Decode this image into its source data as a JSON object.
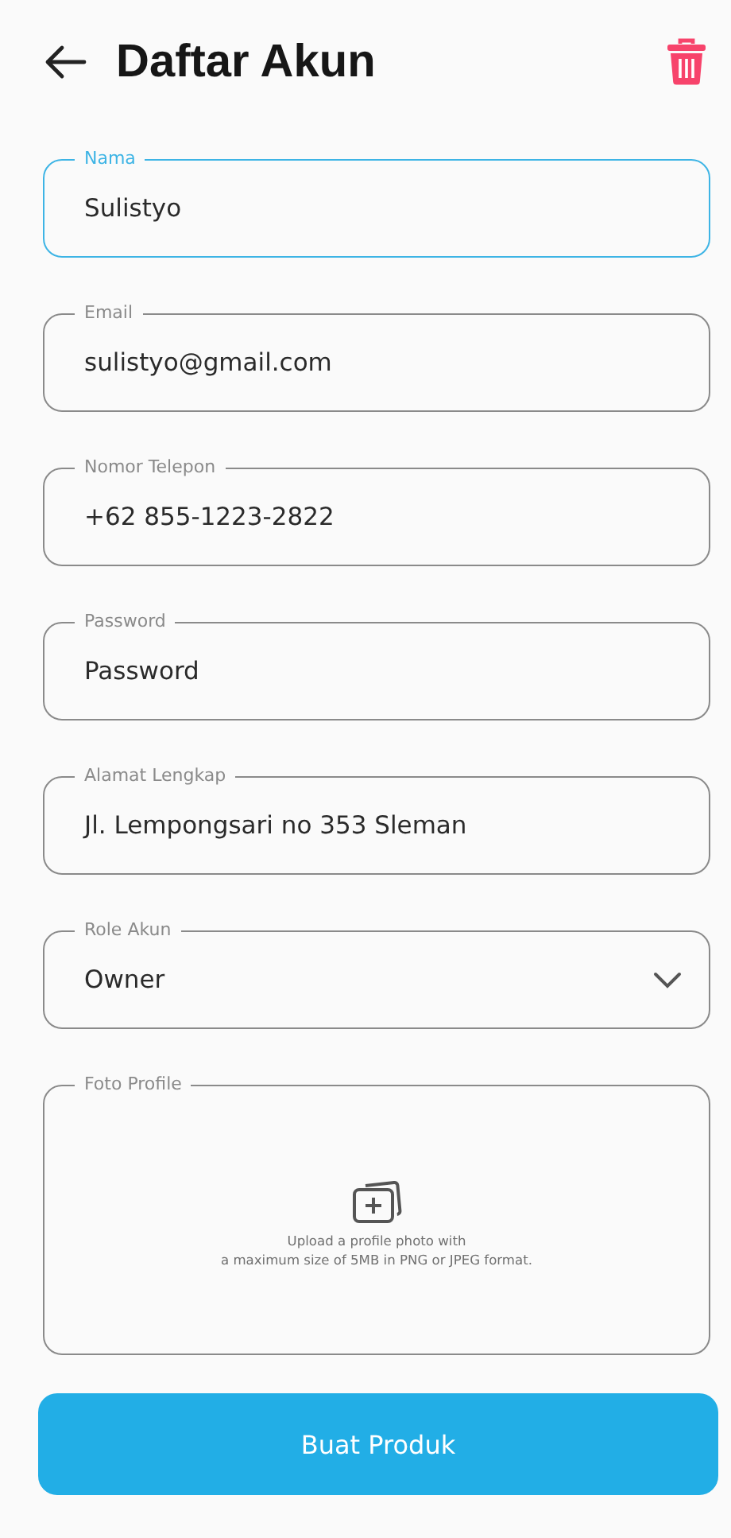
{
  "header": {
    "title": "Daftar Akun"
  },
  "fields": [
    {
      "kind": "text",
      "label": "Nama",
      "value": "Sulistyo",
      "focused": true
    },
    {
      "kind": "text",
      "label": "Email",
      "value": "sulistyo@gmail.com",
      "focused": false
    },
    {
      "kind": "text",
      "label": "Nomor Telepon",
      "value": "+62 855-1223-2822",
      "focused": false
    },
    {
      "kind": "text",
      "label": "Password",
      "value": "Password",
      "focused": false
    },
    {
      "kind": "text",
      "label": "Alamat Lengkap",
      "value": "Jl. Lempongsari no 353 Sleman",
      "focused": false
    },
    {
      "kind": "select",
      "label": "Role Akun",
      "value": "Owner",
      "focused": false
    }
  ],
  "upload": {
    "label": "Foto Profile",
    "hint_lines": [
      "Upload a profile photo with",
      "a maximum size of 5MB in PNG or JPEG format."
    ]
  },
  "submit_button": "Buat Produk"
}
